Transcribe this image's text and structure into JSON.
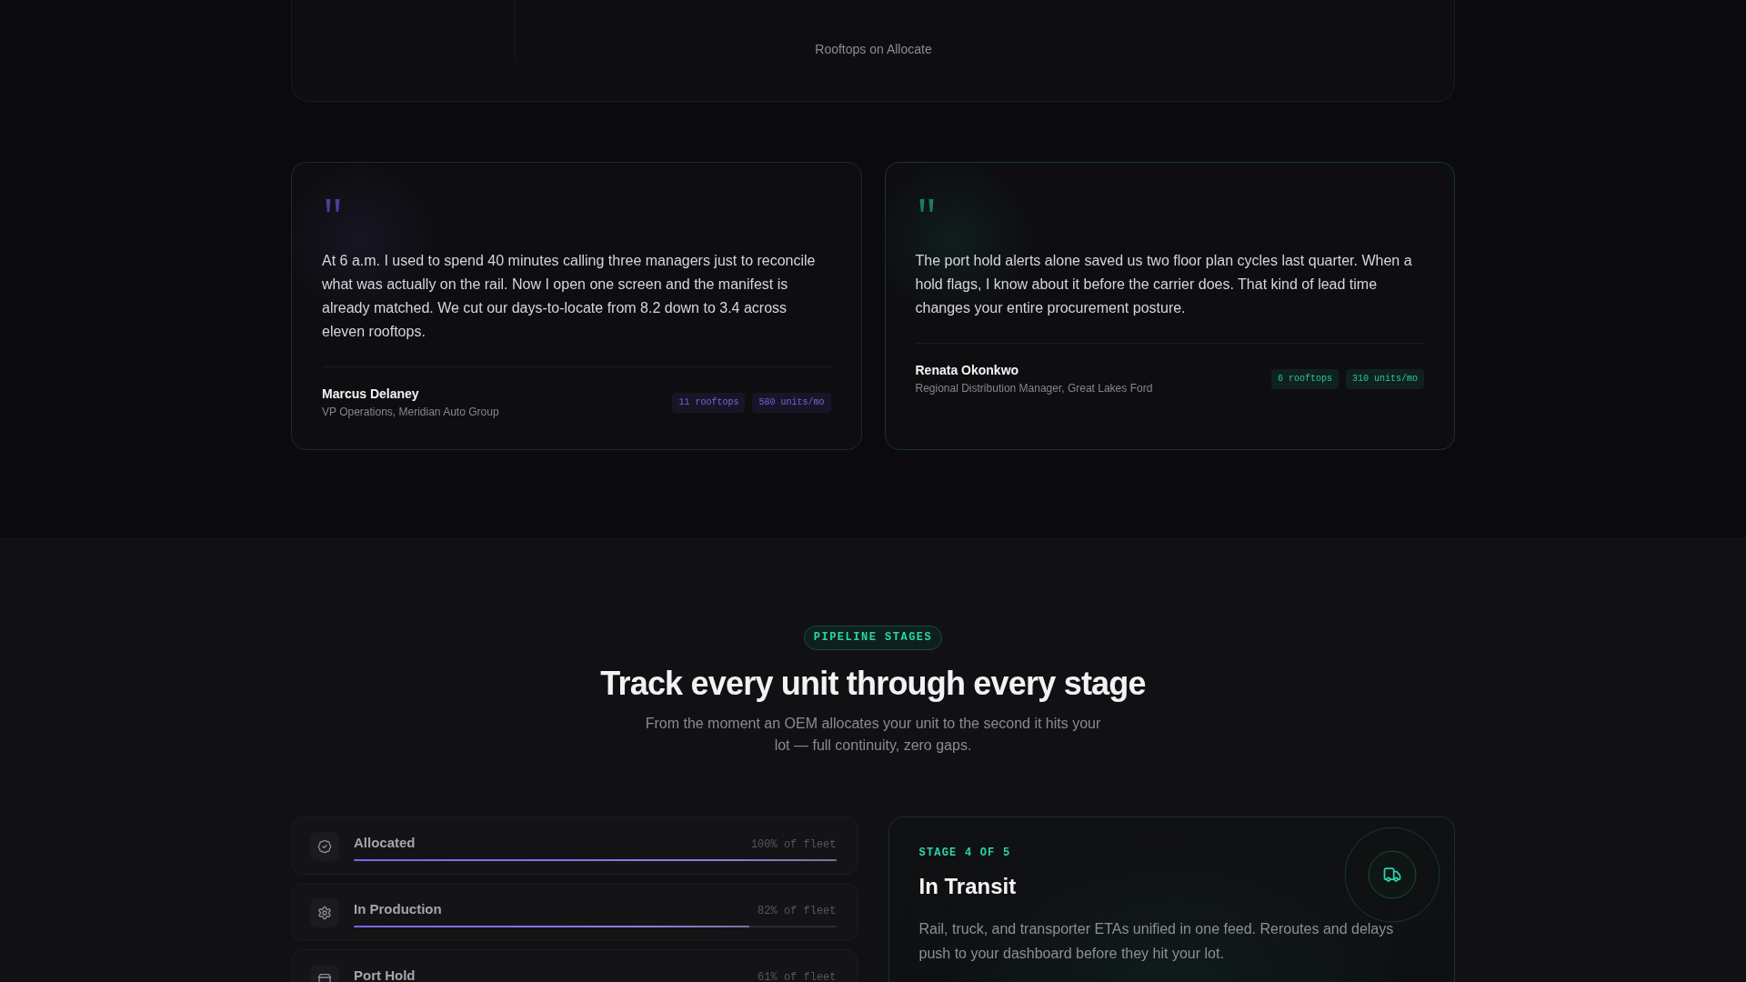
{
  "stat_card": {
    "label": "Rooftops on Allocate"
  },
  "testimonials": [
    {
      "quote": "At 6 a.m. I used to spend 40 minutes calling three managers just to reconcile what was actually on the rail. Now I open one screen and the manifest is already matched. We cut our days-to-locate from 8.2 down to 3.4 across eleven rooftops.",
      "name": "Marcus Delaney",
      "role": "VP Operations, Meridian Auto Group",
      "tags": [
        "11 rooftops",
        "580 units/mo"
      ],
      "color": "#4c3f96"
    },
    {
      "quote": "The port hold alerts alone saved us two floor plan cycles last quarter. When a hold flags, I know about it before the carrier does. That kind of lead time changes your entire procurement posture.",
      "name": "Renata Okonkwo",
      "role": "Regional Distribution Manager, Great Lakes Ford",
      "tags": [
        "6 rooftops",
        "310 units/mo"
      ],
      "color": "#1c7d67"
    }
  ],
  "pipeline": {
    "badge": "PIPELINE STAGES",
    "title": "Track every unit through every stage",
    "subtitle": "From the moment an OEM allocates your unit to the second it hits your lot — full continuity, zero gaps.",
    "stages": [
      {
        "label": "Allocated",
        "reading": "100% of fleet",
        "level": 1
      },
      {
        "label": "In Production",
        "reading": "82% of fleet",
        "level": 0.82
      },
      {
        "label": "Port Hold",
        "reading": "61% of fleet"
      }
    ],
    "detail": {
      "eyebrow": "STAGE 4 OF 5",
      "title": "In Transit",
      "description": "Rail, truck, and transporter ETAs unified in one feed. Reroutes and delays push to your dashboard before they hit your lot."
    }
  }
}
